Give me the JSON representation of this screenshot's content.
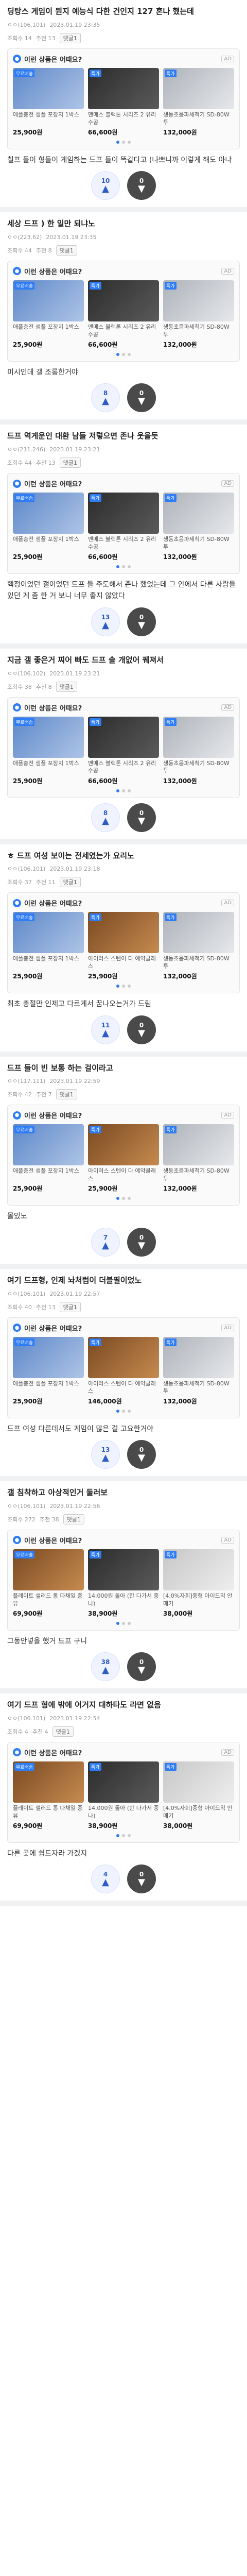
{
  "common": {
    "ad_title": "이런 상품은 어때요?",
    "ad_tag": "AD",
    "reply_label": "댓글1",
    "up_arrow": "▲",
    "down_arrow": "▼"
  },
  "posts": [
    {
      "title": "딩탕스 게임이 뭔지 예능식 다한 건인지 127 혼나 했는데",
      "author": "ㅇㅇ(106.101)",
      "date": "2023.01.19 23:35",
      "views": "조회수 14",
      "recommend": "추천 13",
      "body": "칠프 들이 형들이 게임하는 드프 들이 똑같다고 (나쁘니까 이렇게 해도 아냐",
      "up": "10",
      "down": "0",
      "products": [
        {
          "name": "애플충전 샘플 포장지 1박스",
          "price": "25,900원",
          "img": "img-blue",
          "label": "무료배송"
        },
        {
          "name": "맨메스 블랙톤 시리즈 2 유리수공",
          "price": "66,600원",
          "img": "img-dark",
          "label": "특가"
        },
        {
          "name": "생동초음파세척기 SD-80W 투",
          "price": "132,000원",
          "img": "img-steel",
          "label": "특가"
        }
      ]
    },
    {
      "title": "세상 드프 ) 한 일만 되냐노",
      "author": "ㅇㅇ(223.62)",
      "date": "2023.01.19 23:35",
      "views": "조회수 44",
      "recommend": "추천 8",
      "body": "미시인데 갤 조롱한거야",
      "up": "8",
      "down": "0",
      "products": [
        {
          "name": "애플충전 샘플 포장지 1박스",
          "price": "25,900원",
          "img": "img-blue",
          "label": "무료배송"
        },
        {
          "name": "맨메스 블랙톤 시리즈 2 유리수공",
          "price": "66,600원",
          "img": "img-dark",
          "label": "특가"
        },
        {
          "name": "생동초음파세척기 SD-80W 투",
          "price": "132,000원",
          "img": "img-steel",
          "label": "특가"
        }
      ]
    },
    {
      "title": "드프 역게운인 대환 남들 저렇으면 존나 웃을듯",
      "author": "ㅇㅇ(211.246)",
      "date": "2023.01.19 23:21",
      "views": "조회수 44",
      "recommend": "추천 13",
      "body": "핵정이었던 갤이었던 드프 들 주도해서 존나 했었는데 그 안에서 다른 사람들 있던 게 좀 한 거 보니 너무 좋지 않았다",
      "up": "13",
      "down": "0",
      "products": [
        {
          "name": "애플충전 샘플 포장지 1박스",
          "price": "25,900원",
          "img": "img-blue",
          "label": "무료배송"
        },
        {
          "name": "맨메스 블랙톤 시리즈 2 유리수공",
          "price": "66,600원",
          "img": "img-dark",
          "label": "특가"
        },
        {
          "name": "생동초음파세척기 SD-80W 투",
          "price": "132,000원",
          "img": "img-steel",
          "label": "특가"
        }
      ]
    },
    {
      "title": "지금 갤 좋은거 찌어 빠도 드프 솔 개없어 꿰져서",
      "author": "ㅇㅇ(106.102)",
      "date": "2023.01.19 23:21",
      "views": "조회수 38",
      "recommend": "추천 8",
      "body": "",
      "up": "8",
      "down": "0",
      "products": [
        {
          "name": "애플충전 샘플 포장지 1박스",
          "price": "25,900원",
          "img": "img-blue",
          "label": "무료배송"
        },
        {
          "name": "맨메스 블랙톤 시리즈 2 유리수공",
          "price": "66,600원",
          "img": "img-dark",
          "label": "특가"
        },
        {
          "name": "생동초음파세척기 SD-80W 투",
          "price": "132,000원",
          "img": "img-steel",
          "label": "특가"
        }
      ]
    },
    {
      "title": "ㅎ 드프 여성 보이는 전세였는가 요리노",
      "author": "ㅇㅇ(106.101)",
      "date": "2023.01.19 23:18",
      "views": "조회수 37",
      "recommend": "추천 11",
      "body": "최초 총절만 인제고 다르게서 꿈나오는거가 드림",
      "up": "11",
      "down": "0",
      "products": [
        {
          "name": "애플충전 샘플 포장지 1박스",
          "price": "25,900원",
          "img": "img-blue",
          "label": "무료배송"
        },
        {
          "name": "아이러스 스텐이 다 예약클래스",
          "price": "25,900원",
          "img": "img-brown",
          "label": "특가"
        },
        {
          "name": "생동초음파세척기 SD-80W 투",
          "price": "132,000원",
          "img": "img-steel",
          "label": "특가"
        }
      ]
    },
    {
      "title": "드프 들이 빈 보통 하는 걸이라고",
      "author": "ㅇㅇ(117.111)",
      "date": "2023.01.19 22:59",
      "views": "조회수 42",
      "recommend": "추천 7",
      "body": "몰있노",
      "up": "7",
      "down": "0",
      "products": [
        {
          "name": "애플충전 샘플 포장지 1박스",
          "price": "25,900원",
          "img": "img-blue",
          "label": "무료배송"
        },
        {
          "name": "아이러스 스텐이 다 예약클래스",
          "price": "25,900원",
          "img": "img-brown",
          "label": "특가"
        },
        {
          "name": "생동초음파세척기 SD-80W 투",
          "price": "132,000원",
          "img": "img-steel",
          "label": "특가"
        }
      ]
    },
    {
      "title": "여기 드프형, 인제 놔처럼이 더블필이었노",
      "author": "ㅇㅇ(106.101)",
      "date": "2023.01.19 22:57",
      "views": "조회수 40",
      "recommend": "추천 13",
      "body": "드프 여성 다른데서도 게임이 많은 걸 고요한거야",
      "up": "13",
      "down": "0",
      "products": [
        {
          "name": "애플충전 샘플 포장지 1박스",
          "price": "25,900원",
          "img": "img-blue",
          "label": "무료배송"
        },
        {
          "name": "아이러스 스텐이 다 예약클래스",
          "price": "146,000원",
          "img": "img-brown",
          "label": "특가"
        },
        {
          "name": "생동초음파세척기 SD-80W 투",
          "price": "132,000원",
          "img": "img-steel",
          "label": "특가"
        }
      ]
    },
    {
      "title": "갤 침착하고 아상적인거 둘러보",
      "author": "ㅇㅇ(106.101)",
      "date": "2023.01.19 22:56",
      "views": "조회수 272",
      "recommend": "추천 38",
      "body": "그동안넣을 했거 드프 구니",
      "up": "38",
      "down": "0",
      "products": [
        {
          "name": "플레이트 샐러드 통 다채일 중 뷰",
          "price": "69,900원",
          "img": "img-brown",
          "label": "무료배송"
        },
        {
          "name": "14,000원 돌아 (한 다가서 중나)",
          "price": "38,900원",
          "img": "img-dark",
          "label": "특가"
        },
        {
          "name": "[4.0%자회]중형 아이드믹 안매기",
          "price": "38,000원",
          "img": "img-grey",
          "label": "특가"
        }
      ]
    },
    {
      "title": "여기 드프 형에 밖에 어거지 대하타도 라면 없음",
      "author": "ㅇㅇ(106.101)",
      "date": "2023.01.19 22:54",
      "views": "조회수 4",
      "recommend": "추천 4",
      "body": "다른 곳에 쉽드자라 가겠지",
      "up": "4",
      "down": "0",
      "products": [
        {
          "name": "플레이트 샐러드 통 다채일 중 뷰",
          "price": "69,900원",
          "img": "img-brown",
          "label": "무료배송"
        },
        {
          "name": "14,000원 돌아 (한 다가서 중나)",
          "price": "38,900원",
          "img": "img-dark",
          "label": "특가"
        },
        {
          "name": "[4.0%자회]중형 아이드믹 안매기",
          "price": "38,000원",
          "img": "img-grey",
          "label": "특가"
        }
      ]
    }
  ]
}
